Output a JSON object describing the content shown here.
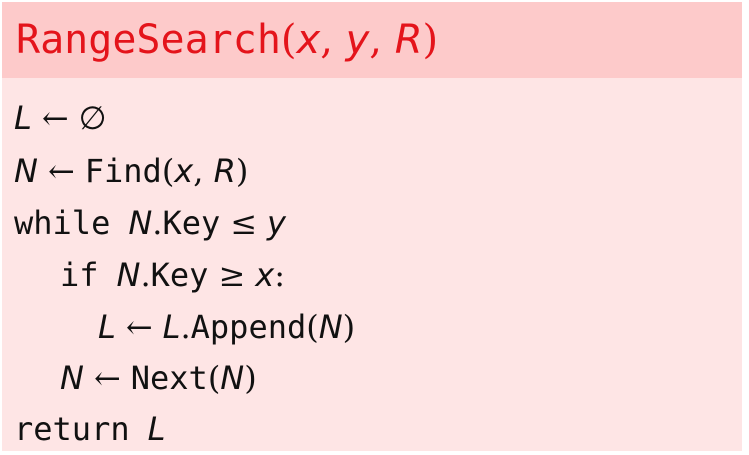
{
  "header": {
    "func": "RangeSearch",
    "open": "(",
    "arg1": "x",
    "comma1": ", ",
    "arg2": "y",
    "comma2": ", ",
    "arg3": "R",
    "close": ")"
  },
  "lines": [
    {
      "lhs": "L",
      "arrow": "←",
      "rhs": "∅"
    },
    {
      "lhs": "N",
      "arrow": "←",
      "fn": "Find",
      "open": "(",
      "a1": "x",
      "comma": ", ",
      "a2": "R",
      "close": ")"
    },
    {
      "kw": "while",
      "var": "N",
      "dot": ".",
      "field": "Key",
      "op": "≤",
      "rhs": "y"
    },
    {
      "kw": "if",
      "var": "N",
      "dot": ".",
      "field": "Key",
      "op": "≥",
      "rhs": "x",
      "colon": ":"
    },
    {
      "lhs": "L",
      "arrow": "←",
      "var": "L",
      "dot": ".",
      "fn": "Append",
      "open": "(",
      "arg": "N",
      "close": ")"
    },
    {
      "lhs": "N",
      "arrow": "←",
      "fn": "Next",
      "open": "(",
      "arg": "N",
      "close": ")"
    },
    {
      "kw": "return",
      "var": "L"
    }
  ],
  "colors": {
    "header_bg": "#fdcaca",
    "body_bg": "#fee5e5",
    "title": "#e4141b",
    "text": "#111111"
  }
}
